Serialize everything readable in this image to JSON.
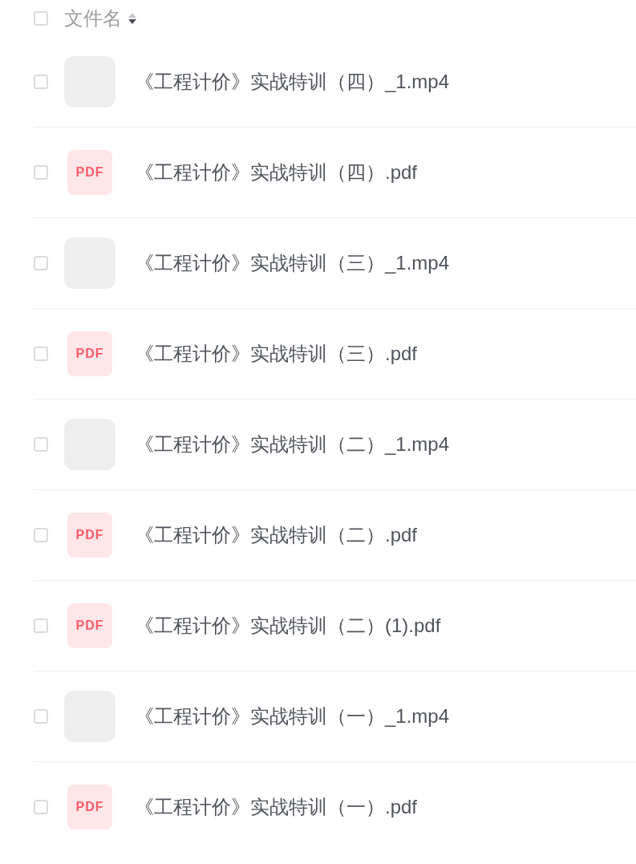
{
  "header": {
    "checked": false,
    "label": "文件名"
  },
  "files": [
    {
      "kind": "video",
      "checked": false,
      "name": "《工程计价》实战特训（四）_1.mp4"
    },
    {
      "kind": "pdf",
      "checked": false,
      "badge": "PDF",
      "name": "《工程计价》实战特训（四）.pdf"
    },
    {
      "kind": "video",
      "checked": false,
      "name": "《工程计价》实战特训（三）_1.mp4"
    },
    {
      "kind": "pdf",
      "checked": false,
      "badge": "PDF",
      "name": "《工程计价》实战特训（三）.pdf"
    },
    {
      "kind": "video",
      "checked": false,
      "name": "《工程计价》实战特训（二）_1.mp4"
    },
    {
      "kind": "pdf",
      "checked": false,
      "badge": "PDF",
      "name": "《工程计价》实战特训（二）.pdf"
    },
    {
      "kind": "pdf",
      "checked": false,
      "badge": "PDF",
      "name": "《工程计价》实战特训（二）(1).pdf"
    },
    {
      "kind": "video",
      "checked": false,
      "name": "《工程计价》实战特训（一）_1.mp4"
    },
    {
      "kind": "pdf",
      "checked": false,
      "badge": "PDF",
      "name": "《工程计价》实战特训（一）.pdf"
    }
  ]
}
